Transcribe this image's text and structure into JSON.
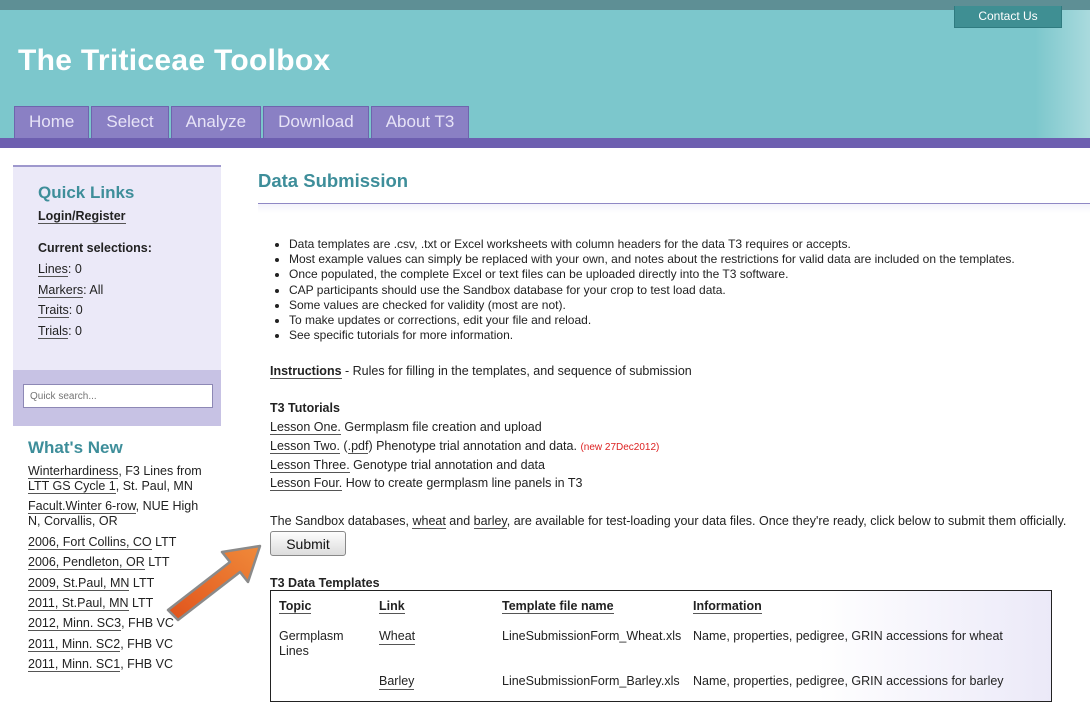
{
  "header": {
    "site_title": "The Triticeae Toolbox",
    "contact_label": "Contact Us",
    "nav": [
      "Home",
      "Select",
      "Analyze",
      "Download",
      "About T3"
    ],
    "colors": {
      "header_bg": "#7cc7cc",
      "nav_tab": "#8a80c4",
      "accent": "#3e8e9a"
    }
  },
  "sidebar": {
    "quick_links_title": "Quick Links",
    "login_label": "Login/Register",
    "current_selections_label": "Current selections:",
    "selections": [
      {
        "label": "Lines",
        "value": ": 0"
      },
      {
        "label": "Markers",
        "value": ": All"
      },
      {
        "label": "Traits",
        "value": ": 0"
      },
      {
        "label": "Trials",
        "value": ": 0"
      }
    ],
    "search_placeholder": "Quick search...",
    "whats_new_title": "What's New",
    "whats_new": [
      {
        "link": "Winterhardiness",
        "rest": ", F3 Lines from"
      },
      {
        "line2_link": "LTT GS Cycle 1",
        "line2_rest": ", St. Paul, MN"
      },
      {
        "link": "Facult.Winter 6-row",
        "rest": ", NUE High"
      },
      {
        "plain": "N, Corvallis, OR"
      },
      {
        "link": "2006, Fort Collins, CO",
        "rest": " LTT"
      },
      {
        "link": "2006, Pendleton, OR",
        "rest": " LTT"
      },
      {
        "link": "2009, St.Paul, MN",
        "rest": " LTT"
      },
      {
        "link": "2011, St.Paul, MN",
        "rest": " LTT"
      },
      {
        "link": "2012, Minn. SC3",
        "rest": ", FHB VC"
      },
      {
        "link": "2011, Minn. SC2",
        "rest": ", FHB VC"
      },
      {
        "link": "2011, Minn. SC1",
        "rest": ", FHB VC"
      }
    ]
  },
  "main": {
    "title": "Data Submission",
    "bullets": [
      "Data templates are .csv, .txt or Excel worksheets with column headers for the data T3 requires or accepts.",
      "Most example values can simply be replaced with your own, and notes about the restrictions for valid data are included on the templates.",
      "Once populated, the complete Excel or text files can be uploaded directly into the T3 software.",
      "CAP participants should use the Sandbox database for your crop to test load data.",
      "Some values are checked for validity (most are not).",
      "To make updates or corrections, edit your file and reload.",
      "See specific tutorials for more information."
    ],
    "instructions_link": "Instructions",
    "instructions_rest": " - Rules for filling in the templates, and sequence of submission",
    "tutorials_heading": "T3 Tutorials",
    "tutorials": [
      {
        "link": "Lesson One.",
        "rest": " Germplasm file creation and upload"
      },
      {
        "link": "Lesson Two.",
        "paren_link": ".pdf",
        "rest": " Phenotype trial annotation and data.",
        "new_tag": "(new 27Dec2012)"
      },
      {
        "link": "Lesson Three.",
        "rest": " Genotype trial annotation and data"
      },
      {
        "link": "Lesson Four.",
        "rest": " How to create germplasm line panels in T3"
      }
    ],
    "sandbox_prefix": "The Sandbox databases, ",
    "sandbox_wheat": "wheat",
    "sandbox_and": " and ",
    "sandbox_barley": "barley",
    "sandbox_suffix": ", are available for test-loading your data files. Once they're ready, click below to submit them officially.",
    "submit_label": "Submit",
    "templates_heading": "T3 Data Templates",
    "templates_headers": [
      "Topic",
      "Link",
      "Template file name",
      "Information"
    ],
    "templates_rows": [
      {
        "topic": "Germplasm Lines",
        "link": "Wheat",
        "file": "LineSubmissionForm_Wheat.xls",
        "info": "Name, properties, pedigree, GRIN accessions for wheat"
      },
      {
        "topic": "",
        "link": "Barley",
        "file": "LineSubmissionForm_Barley.xls",
        "info": "Name, properties, pedigree, GRIN accessions for barley"
      }
    ]
  }
}
